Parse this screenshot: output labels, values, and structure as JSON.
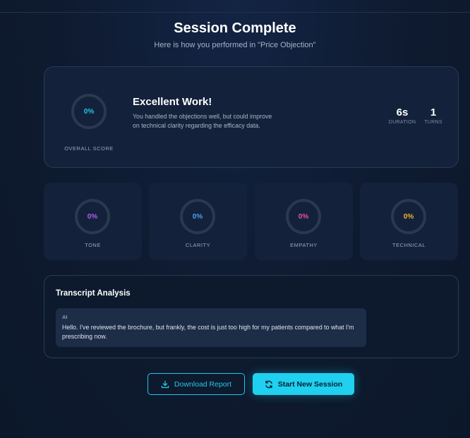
{
  "header": {
    "title": "Session Complete",
    "subtitle": "Here is how you performed in \"Price Objection\""
  },
  "summary": {
    "overall_score": "0%",
    "overall_label": "OVERALL SCORE",
    "headline": "Excellent Work!",
    "feedback": "You handled the objections well, but could improve on technical clarity regarding the efficacy data.",
    "duration_value": "6s",
    "duration_label": "DURATION",
    "turns_value": "1",
    "turns_label": "TURNS"
  },
  "metrics": [
    {
      "label": "TONE",
      "value": "0%",
      "color": "#b05cf0"
    },
    {
      "label": "CLARITY",
      "value": "0%",
      "color": "#4f9cf5"
    },
    {
      "label": "EMPATHY",
      "value": "0%",
      "color": "#ee4fa0"
    },
    {
      "label": "TECHNICAL",
      "value": "0%",
      "color": "#f2b52a"
    }
  ],
  "transcript": {
    "title": "Transcript Analysis",
    "messages": [
      {
        "speaker": "AI",
        "text": "Hello. I've reviewed the brochure, but frankly, the cost is just too high for my patients compared to what I'm prescribing now."
      }
    ]
  },
  "actions": {
    "download_label": "Download Report",
    "new_session_label": "Start New Session"
  },
  "colors": {
    "accent": "#1fd0f0",
    "background": "#0f1b30",
    "card": "#13213a"
  }
}
